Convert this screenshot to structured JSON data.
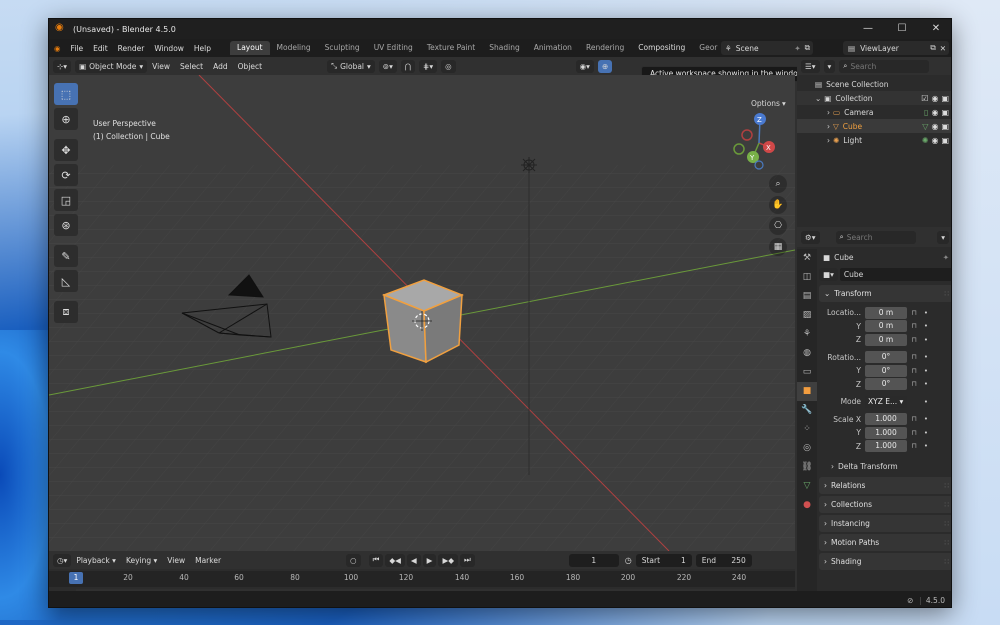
{
  "window": {
    "title": "(Unsaved) - Blender 4.5.0"
  },
  "menu": [
    "File",
    "Edit",
    "Render",
    "Window",
    "Help"
  ],
  "workspace_tabs": [
    {
      "label": "Layout",
      "active": true
    },
    {
      "label": "Modeling"
    },
    {
      "label": "Sculpting"
    },
    {
      "label": "UV Editing"
    },
    {
      "label": "Texture Paint"
    },
    {
      "label": "Shading"
    },
    {
      "label": "Animation"
    },
    {
      "label": "Rendering"
    },
    {
      "label": "Compositing"
    },
    {
      "label": "Geor"
    }
  ],
  "scene": {
    "label": "Scene"
  },
  "view_layer": {
    "label": "ViewLayer"
  },
  "viewport_header": {
    "mode": "Object Mode",
    "view": "View",
    "select": "Select",
    "add": "Add",
    "object": "Object",
    "orientation": "Global",
    "options": "Options"
  },
  "tooltip": "Active workspace showing in the window.",
  "viewport": {
    "perspective": "User Perspective",
    "context": "(1) Collection | Cube",
    "gizmo_axes": [
      "X",
      "Y",
      "Z"
    ]
  },
  "outliner": {
    "search_placeholder": "Search",
    "root": "Scene Collection",
    "collection": "Collection",
    "items": [
      {
        "label": "Camera",
        "color": "#e0e0e0"
      },
      {
        "label": "Cube",
        "color": "#f0a040"
      },
      {
        "label": "Light",
        "color": "#e0e0e0"
      }
    ]
  },
  "properties": {
    "search_placeholder": "Search",
    "object_name": "Cube",
    "data_name": "Cube",
    "transform_header": "Transform",
    "location_label": "Locatio...",
    "location": [
      "0 m",
      "0 m",
      "0 m"
    ],
    "rotation_label": "Rotatio...",
    "rotation": [
      "0°",
      "0°",
      "0°"
    ],
    "mode_label": "Mode",
    "mode_value": "XYZ E...",
    "scale_label": "Scale X",
    "scale": [
      "1.000",
      "1.000",
      "1.000"
    ],
    "axis_y": "Y",
    "axis_z": "Z",
    "delta_transform": "Delta Transform",
    "panels": [
      "Relations",
      "Collections",
      "Instancing",
      "Motion Paths",
      "Shading"
    ]
  },
  "timeline": {
    "playback": "Playback",
    "keying": "Keying",
    "view": "View",
    "marker": "Marker",
    "current_frame": "1",
    "start_label": "Start",
    "start": "1",
    "end_label": "End",
    "end": "250",
    "ruler": [
      "1",
      "20",
      "40",
      "60",
      "80",
      "100",
      "120",
      "140",
      "160",
      "180",
      "200",
      "220",
      "240"
    ]
  },
  "status": {
    "version": "4.5.0"
  },
  "colors": {
    "accent": "#4772b3",
    "selection": "#f0a040"
  }
}
